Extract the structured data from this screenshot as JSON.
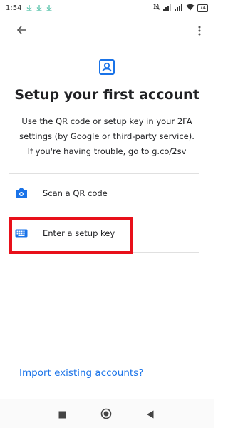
{
  "status_bar": {
    "time": "1:54",
    "battery": "74",
    "download_icons": [
      "download-icon",
      "download-icon",
      "download-icon"
    ],
    "right_icons": [
      "mute-icon",
      "signal-icon",
      "signal-icon",
      "wifi-icon",
      "battery-icon"
    ]
  },
  "app_bar": {
    "back_icon": "arrow-back-icon",
    "more_icon": "more-vert-icon"
  },
  "header": {
    "icon": "account-box-icon",
    "title": "Setup your first account",
    "description": "Use the QR code or setup key in your 2FA settings (by Google or third-party service). If you're having trouble, go to g.co/2sv"
  },
  "options": [
    {
      "label": "Scan a QR code",
      "icon": "camera-icon"
    },
    {
      "label": "Enter a setup key",
      "icon": "keyboard-icon"
    }
  ],
  "import_link": "Import existing accounts?",
  "nav_bar": {
    "buttons": [
      "recents-icon",
      "home-icon",
      "back-triangle-icon"
    ]
  },
  "colors": {
    "accent": "#1a73e8",
    "highlight": "#e8101a",
    "divider": "#e0e0e0",
    "text": "#202124"
  }
}
